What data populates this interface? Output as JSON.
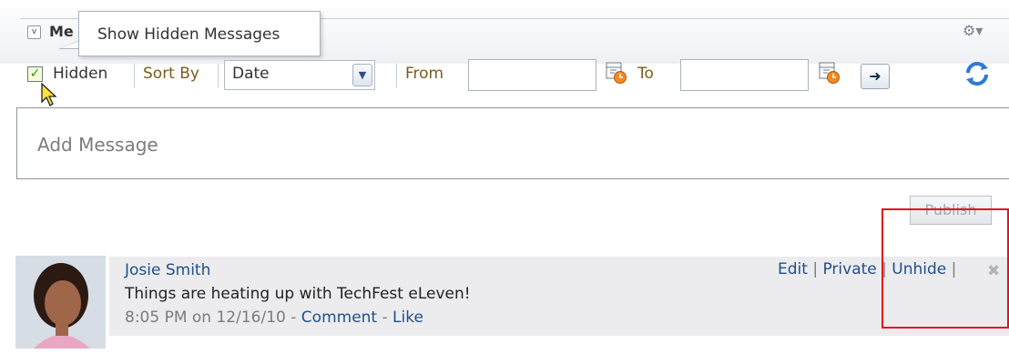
{
  "header": {
    "title": "Me",
    "collapse_glyph": "v",
    "tooltip": "Show Hidden Messages",
    "gear_glyph": "⚙▾"
  },
  "toolbar": {
    "hidden_checked": true,
    "hidden_label": "Hidden",
    "sortby_label": "Sort By",
    "sort_value": "Date",
    "dropdown_glyph": "▼",
    "from_label": "From",
    "from_value": "",
    "to_label": "To",
    "to_value": "",
    "go_glyph": "➜"
  },
  "composer": {
    "placeholder": "Add Message"
  },
  "publish_label": "Publish",
  "message": {
    "author": "Josie Smith",
    "text": "Things are heating up with TechFest eLeven!",
    "time": "8:05 PM on 12/16/10",
    "dash1": " - ",
    "comment": "Comment",
    "dash2": " - ",
    "like": "Like",
    "edit": "Edit",
    "private": "Private",
    "unhide": "Unhide",
    "bar": " | "
  },
  "colors": {
    "link": "#1f4e8c",
    "highlight": "#e3121b",
    "label_brown": "#7a5c1e"
  }
}
